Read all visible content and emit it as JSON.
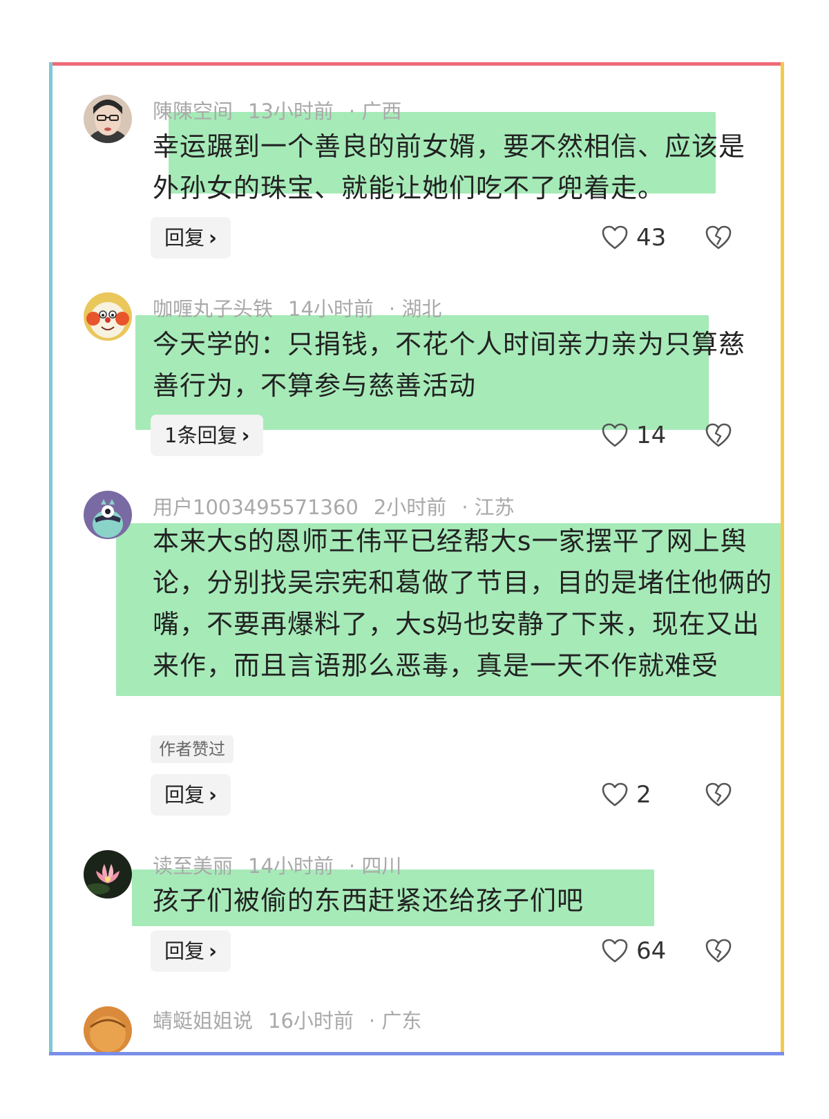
{
  "colors": {
    "border_top": "#ee6a78",
    "border_left": "#7dc9d6",
    "border_right": "#f4c94c",
    "border_bottom": "#7a8ee8",
    "highlight": "#a6eab8"
  },
  "comments": [
    {
      "username": "陳陳空间",
      "time": "13小时前",
      "location": "· 广西",
      "text": "幸运蹍到一个善良的前女婿，要不然相信、应该是外孙女的珠宝、就能让她们吃不了兜着走。",
      "reply_label": "回复",
      "likes": "43",
      "avatar_icon": "user-photo-avatar"
    },
    {
      "username": "咖喱丸子头铁",
      "time": "14小时前",
      "location": "· 湖北",
      "text": "今天学的：只捐钱，不花个人时间亲力亲为只算慈善行为，不算参与慈善活动",
      "reply_label": "1条回复",
      "likes": "14",
      "avatar_icon": "cartoon-face-avatar"
    },
    {
      "username": "用户1003495571360",
      "time": "2小时前",
      "location": "· 江苏",
      "text": "本来大s的恩师王伟平已经帮大s一家摆平了网上舆论，分别找吴宗宪和葛做了节目，目的是堵住他俩的嘴，不要再爆料了，大s妈也安静了下来，现在又出来作，而且言语那么恶毒，真是一天不作就难受",
      "tag": "作者赞过",
      "reply_label": "回复",
      "likes": "2",
      "avatar_icon": "monster-avatar"
    },
    {
      "username": "读至美丽",
      "time": "14小时前",
      "location": "· 四川",
      "text": "孩子们被偷的东西赶紧还给孩子们吧",
      "reply_label": "回复",
      "likes": "64",
      "avatar_icon": "lotus-avatar"
    },
    {
      "username": "蜻蜓姐姐说",
      "time": "16小时前",
      "location": "· 广东",
      "avatar_icon": "partial-avatar"
    }
  ]
}
